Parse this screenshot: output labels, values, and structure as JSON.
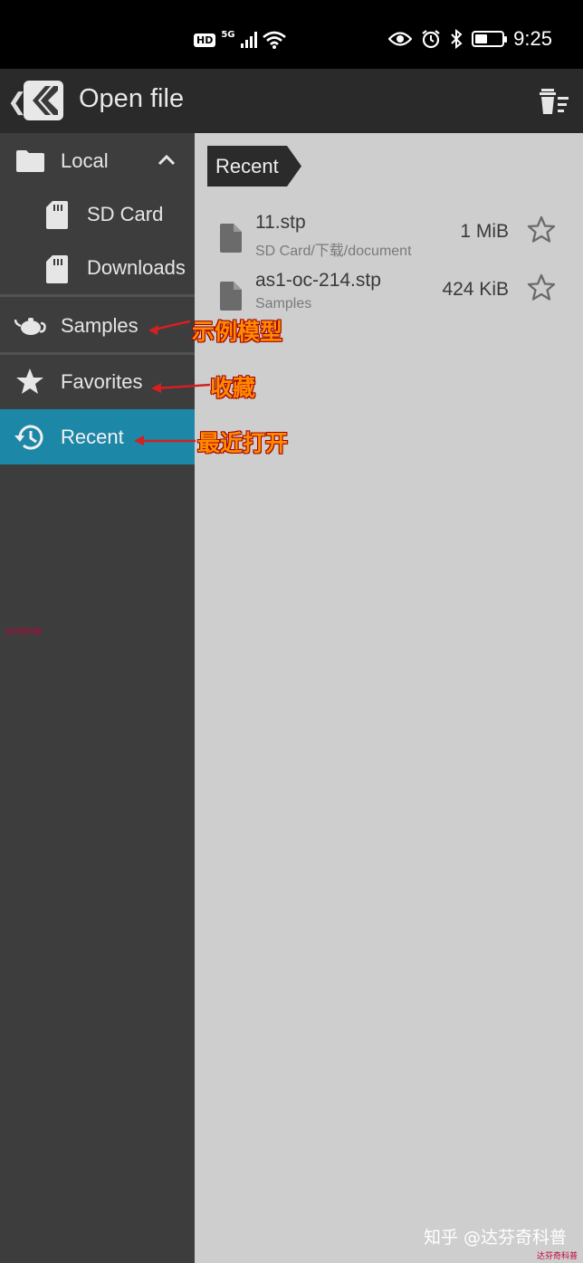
{
  "status_bar": {
    "network_hd": "HD",
    "network_type": "5G",
    "time": "9:25",
    "icons": [
      "signal-icon",
      "wifi-icon",
      "eye-icon",
      "alarm-icon",
      "bluetooth-icon",
      "battery-icon"
    ],
    "battery_level": 0.45
  },
  "app_bar": {
    "title": "Open file",
    "back_icon": "chevron-left-icon",
    "action_icon": "clear-list-icon"
  },
  "sidebar": {
    "local": {
      "label": "Local",
      "icon": "folder-icon",
      "expand_icon": "chevron-up-icon"
    },
    "sd_card": {
      "label": "SD Card",
      "icon": "sd-card-icon"
    },
    "downloads": {
      "label": "Downloads",
      "icon": "sd-card-icon"
    },
    "samples": {
      "label": "Samples",
      "icon": "teapot-icon"
    },
    "favorites": {
      "label": "Favorites",
      "icon": "star-icon"
    },
    "recent": {
      "label": "Recent",
      "icon": "history-icon",
      "active": true
    }
  },
  "main": {
    "breadcrumb": "Recent",
    "files": [
      {
        "name": "11.stp",
        "path": "SD Card/下载/document",
        "size": "1 MiB",
        "favorite": false
      },
      {
        "name": "as1-oc-214.stp",
        "path": "Samples",
        "size": "424 KiB",
        "favorite": false
      }
    ]
  },
  "annotations": {
    "samples_note": "示例模型",
    "favorites_note": "收藏",
    "recent_note": "最近打开"
  },
  "watermark": "知乎 @达芬奇科普",
  "corner_watermark": "达芬奇科普",
  "colors": {
    "accent_active": "#1d87a8",
    "sidebar_bg": "#3d3d3d",
    "main_bg": "#cecece",
    "appbar_bg": "#2a2a2a",
    "annotation_text": "#ff8a00",
    "annotation_arrow": "#d42020"
  }
}
